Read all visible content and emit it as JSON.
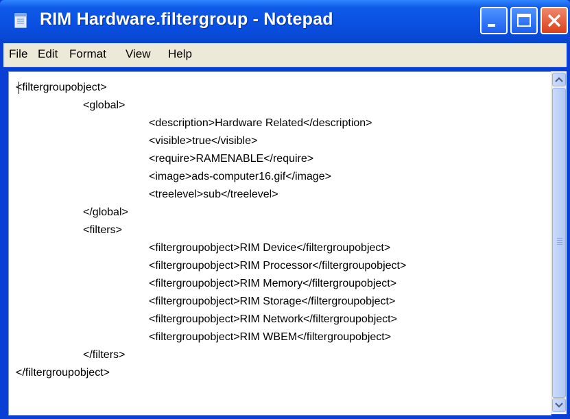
{
  "window": {
    "title": "RIM Hardware.filtergroup - Notepad",
    "controls": [
      "minimize",
      "maximize",
      "close"
    ]
  },
  "menu": {
    "items": [
      "File",
      "Edit",
      "Format",
      "View",
      "Help"
    ]
  },
  "editor": {
    "lines": [
      "<filtergroupobject>",
      "<global>",
      "<description>Hardware Related</description>",
      "<visible>true</visible>",
      "<require>RAMENABLE</require>",
      "<image>ads-computer16.gif</image>",
      "<treelevel>sub</treelevel>",
      "</global>",
      "<filters>",
      "<filtergroupobject>RIM Device</filtergroupobject>",
      "<filtergroupobject>RIM Processor</filtergroupobject>",
      "<filtergroupobject>RIM Memory</filtergroupobject>",
      "<filtergroupobject>RIM Storage</filtergroupobject>",
      "<filtergroupobject>RIM Network</filtergroupobject>",
      "<filtergroupobject>RIM WBEM</filtergroupobject>",
      "</filters>",
      "</filtergroupobject>"
    ]
  },
  "colors": {
    "titlebar": "#0a4fe0",
    "close_button": "#d9401c",
    "menubar": "#ece9d8"
  },
  "icons": {
    "app": "notepad-icon",
    "scroll_up": "scroll-up-arrow-icon",
    "scroll_down": "scroll-down-arrow-icon"
  }
}
